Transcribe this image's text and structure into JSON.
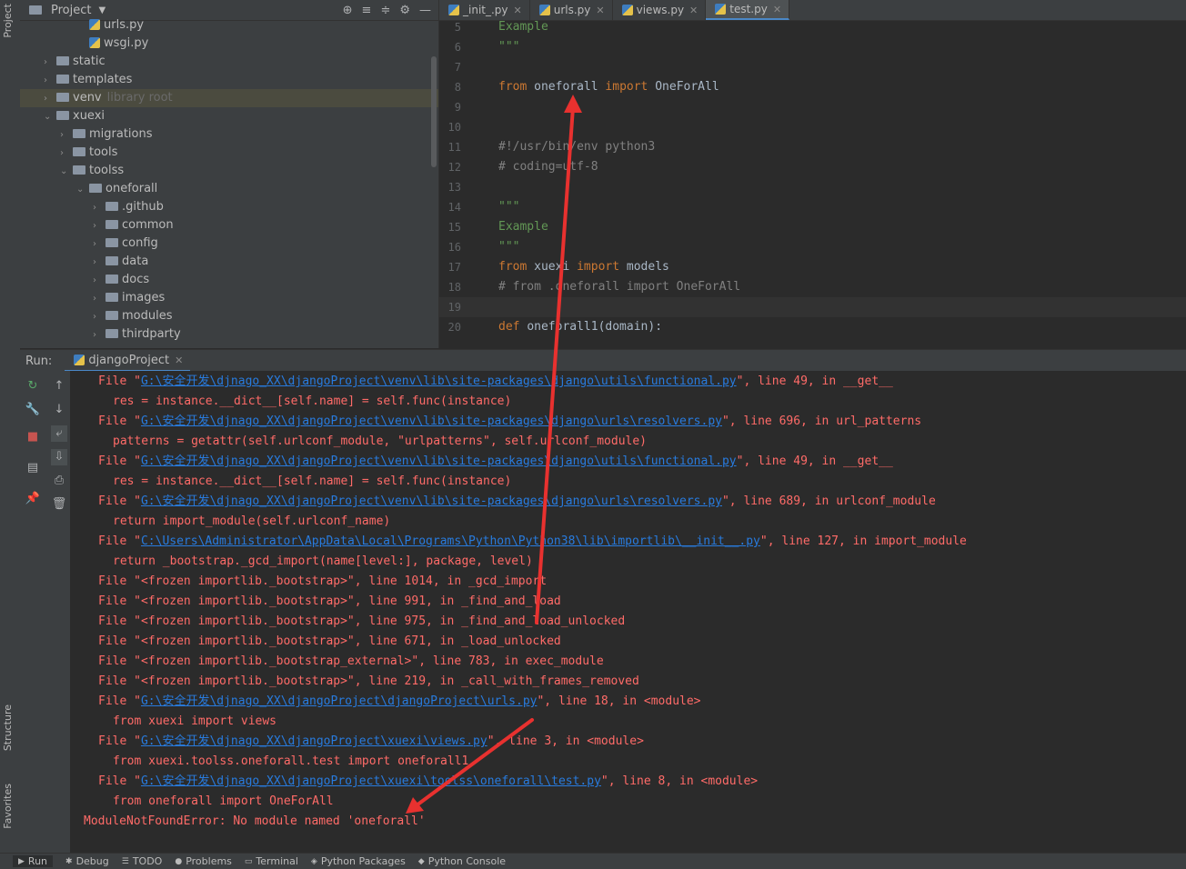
{
  "left_stripe": {
    "project": "Project",
    "structure": "Structure",
    "favorites": "Favorites"
  },
  "project_panel": {
    "title": "Project",
    "tree": [
      {
        "label": "urls.py",
        "type": "file",
        "depth": 3
      },
      {
        "label": "wsgi.py",
        "type": "file",
        "depth": 3
      },
      {
        "label": "static",
        "type": "folder",
        "depth": 1,
        "open": false
      },
      {
        "label": "templates",
        "type": "folder",
        "depth": 1,
        "open": false
      },
      {
        "label": "venv",
        "type": "folder",
        "depth": 1,
        "open": false,
        "hint": "library root",
        "selected": true
      },
      {
        "label": "xuexi",
        "type": "folder",
        "depth": 1,
        "open": true
      },
      {
        "label": "migrations",
        "type": "folder",
        "depth": 2,
        "open": false
      },
      {
        "label": "tools",
        "type": "folder",
        "depth": 2,
        "open": false
      },
      {
        "label": "toolss",
        "type": "folder",
        "depth": 2,
        "open": true
      },
      {
        "label": "oneforall",
        "type": "folder",
        "depth": 3,
        "open": true
      },
      {
        "label": ".github",
        "type": "folder",
        "depth": 4,
        "open": false
      },
      {
        "label": "common",
        "type": "folder",
        "depth": 4,
        "open": false
      },
      {
        "label": "config",
        "type": "folder",
        "depth": 4,
        "open": false
      },
      {
        "label": "data",
        "type": "folder",
        "depth": 4,
        "open": false
      },
      {
        "label": "docs",
        "type": "folder",
        "depth": 4,
        "open": false
      },
      {
        "label": "images",
        "type": "folder",
        "depth": 4,
        "open": false
      },
      {
        "label": "modules",
        "type": "folder",
        "depth": 4,
        "open": false
      },
      {
        "label": "thirdparty",
        "type": "folder",
        "depth": 4,
        "open": false
      }
    ]
  },
  "editor": {
    "tabs": [
      {
        "label": "_init_.py",
        "active": false
      },
      {
        "label": "urls.py",
        "active": false
      },
      {
        "label": "views.py",
        "active": false
      },
      {
        "label": "test.py",
        "active": true
      }
    ],
    "lines": [
      {
        "n": "5",
        "parts": [
          {
            "t": "Example",
            "c": "doc"
          }
        ]
      },
      {
        "n": "6",
        "parts": [
          {
            "t": "\"\"\"",
            "c": "doc"
          }
        ]
      },
      {
        "n": "7",
        "parts": []
      },
      {
        "n": "8",
        "parts": [
          {
            "t": "from ",
            "c": "kw"
          },
          {
            "t": "oneforall ",
            "c": "idn"
          },
          {
            "t": "import ",
            "c": "kw"
          },
          {
            "t": "OneForAll",
            "c": "idn"
          }
        ]
      },
      {
        "n": "9",
        "parts": []
      },
      {
        "n": "10",
        "parts": []
      },
      {
        "n": "11",
        "parts": [
          {
            "t": "#!/usr/bin/env python3",
            "c": "cm"
          }
        ]
      },
      {
        "n": "12",
        "parts": [
          {
            "t": "# coding=utf-8",
            "c": "cm"
          }
        ]
      },
      {
        "n": "13",
        "parts": []
      },
      {
        "n": "14",
        "parts": [
          {
            "t": "\"\"\"",
            "c": "doc"
          }
        ]
      },
      {
        "n": "15",
        "parts": [
          {
            "t": "Example",
            "c": "doc"
          }
        ]
      },
      {
        "n": "16",
        "parts": [
          {
            "t": "\"\"\"",
            "c": "doc"
          }
        ]
      },
      {
        "n": "17",
        "parts": [
          {
            "t": "from ",
            "c": "kw"
          },
          {
            "t": "xuexi ",
            "c": "idn"
          },
          {
            "t": "import ",
            "c": "kw"
          },
          {
            "t": "models",
            "c": "idn"
          }
        ]
      },
      {
        "n": "18",
        "parts": [
          {
            "t": "# from .oneforall import OneForAll",
            "c": "cm"
          }
        ]
      },
      {
        "n": "19",
        "parts": [],
        "current": true
      },
      {
        "n": "20",
        "parts": [
          {
            "t": "def ",
            "c": "kw"
          },
          {
            "t": "oneforall1(domain):",
            "c": "idn"
          }
        ]
      }
    ]
  },
  "run": {
    "label": "Run:",
    "tab": "djangoProject",
    "console": [
      {
        "indent": 2,
        "parts": [
          {
            "t": "File \""
          },
          {
            "t": "G:\\安全开发\\djnago_XX\\djangoProject\\venv\\lib\\site-packages\\django\\utils\\functional.py",
            "link": true
          },
          {
            "t": "\", line 49, in __get__"
          }
        ]
      },
      {
        "indent": 4,
        "parts": [
          {
            "t": "res = instance.__dict__[self.name] = self.func(instance)"
          }
        ]
      },
      {
        "indent": 2,
        "parts": [
          {
            "t": "File \""
          },
          {
            "t": "G:\\安全开发\\djnago_XX\\djangoProject\\venv\\lib\\site-packages\\django\\urls\\resolvers.py",
            "link": true
          },
          {
            "t": "\", line 696, in url_patterns"
          }
        ]
      },
      {
        "indent": 4,
        "parts": [
          {
            "t": "patterns = getattr(self.urlconf_module, \"urlpatterns\", self.urlconf_module)"
          }
        ]
      },
      {
        "indent": 2,
        "parts": [
          {
            "t": "File \""
          },
          {
            "t": "G:\\安全开发\\djnago_XX\\djangoProject\\venv\\lib\\site-packages\\django\\utils\\functional.py",
            "link": true
          },
          {
            "t": "\", line 49, in __get__"
          }
        ]
      },
      {
        "indent": 4,
        "parts": [
          {
            "t": "res = instance.__dict__[self.name] = self.func(instance)"
          }
        ]
      },
      {
        "indent": 2,
        "parts": [
          {
            "t": "File \""
          },
          {
            "t": "G:\\安全开发\\djnago_XX\\djangoProject\\venv\\lib\\site-packages\\django\\urls\\resolvers.py",
            "link": true
          },
          {
            "t": "\", line 689, in urlconf_module"
          }
        ]
      },
      {
        "indent": 4,
        "parts": [
          {
            "t": "return import_module(self.urlconf_name)"
          }
        ]
      },
      {
        "indent": 2,
        "parts": [
          {
            "t": "File \""
          },
          {
            "t": "C:\\Users\\Administrator\\AppData\\Local\\Programs\\Python\\Python38\\lib\\importlib\\__init__.py",
            "link": true
          },
          {
            "t": "\", line 127, in import_module"
          }
        ]
      },
      {
        "indent": 4,
        "parts": [
          {
            "t": "return _bootstrap._gcd_import(name[level:], package, level)"
          }
        ]
      },
      {
        "indent": 2,
        "parts": [
          {
            "t": "File \"<frozen importlib._bootstrap>\", line 1014, in _gcd_import"
          }
        ]
      },
      {
        "indent": 2,
        "parts": [
          {
            "t": "File \"<frozen importlib._bootstrap>\", line 991, in _find_and_load"
          }
        ]
      },
      {
        "indent": 2,
        "parts": [
          {
            "t": "File \"<frozen importlib._bootstrap>\", line 975, in _find_and_load_unlocked"
          }
        ]
      },
      {
        "indent": 2,
        "parts": [
          {
            "t": "File \"<frozen importlib._bootstrap>\", line 671, in _load_unlocked"
          }
        ]
      },
      {
        "indent": 2,
        "parts": [
          {
            "t": "File \"<frozen importlib._bootstrap_external>\", line 783, in exec_module"
          }
        ]
      },
      {
        "indent": 2,
        "parts": [
          {
            "t": "File \"<frozen importlib._bootstrap>\", line 219, in _call_with_frames_removed"
          }
        ]
      },
      {
        "indent": 2,
        "parts": [
          {
            "t": "File \""
          },
          {
            "t": "G:\\安全开发\\djnago_XX\\djangoProject\\djangoProject\\urls.py",
            "link": true
          },
          {
            "t": "\", line 18, in <module>"
          }
        ]
      },
      {
        "indent": 4,
        "parts": [
          {
            "t": "from xuexi import views"
          }
        ]
      },
      {
        "indent": 2,
        "parts": [
          {
            "t": "File \""
          },
          {
            "t": "G:\\安全开发\\djnago_XX\\djangoProject\\xuexi\\views.py",
            "link": true
          },
          {
            "t": "\", line 3, in <module>"
          }
        ]
      },
      {
        "indent": 4,
        "parts": [
          {
            "t": "from xuexi.toolss.oneforall.test import oneforall1"
          }
        ]
      },
      {
        "indent": 2,
        "parts": [
          {
            "t": "File \""
          },
          {
            "t": "G:\\安全开发\\djnago_XX\\djangoProject\\xuexi\\toolss\\oneforall\\test.py",
            "link": true
          },
          {
            "t": "\", line 8, in <module>"
          }
        ]
      },
      {
        "indent": 4,
        "parts": [
          {
            "t": "from oneforall import OneForAll"
          }
        ]
      },
      {
        "indent": 0,
        "parts": [
          {
            "t": "ModuleNotFoundError: No module named 'oneforall'"
          }
        ]
      }
    ]
  },
  "bottom_tabs": [
    {
      "label": "Run",
      "icon": "play-icon",
      "active": true
    },
    {
      "label": "Debug",
      "icon": "bug-icon",
      "active": false
    },
    {
      "label": "TODO",
      "icon": "list-icon",
      "active": false
    },
    {
      "label": "Problems",
      "icon": "info-icon",
      "active": false
    },
    {
      "label": "Terminal",
      "icon": "terminal-icon",
      "active": false
    },
    {
      "label": "Python Packages",
      "icon": "package-icon",
      "active": false
    },
    {
      "label": "Python Console",
      "icon": "python-icon",
      "active": false
    }
  ],
  "colors": {
    "annotation_arrow": "#e8312f",
    "error_text": "#ff6b68",
    "link": "#287bde"
  }
}
